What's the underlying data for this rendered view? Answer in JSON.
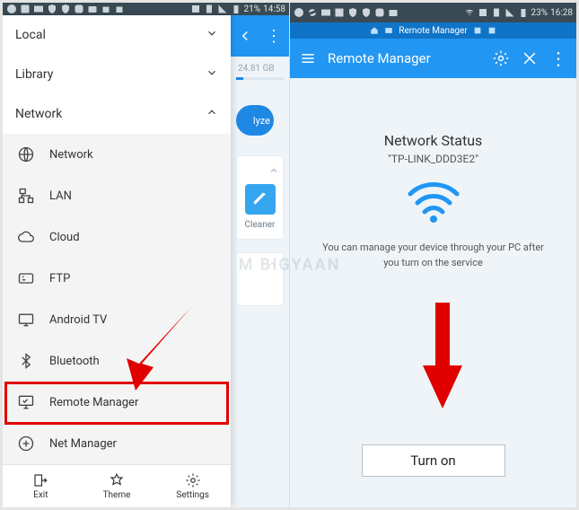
{
  "watermark": "M   BIGYAAN",
  "left": {
    "statusbar": {
      "battery": "21%",
      "time": "14:58"
    },
    "categories": {
      "local": "Local",
      "library": "Library",
      "network": "Network"
    },
    "network_items": [
      {
        "key": "network",
        "label": "Network"
      },
      {
        "key": "lan",
        "label": "LAN"
      },
      {
        "key": "cloud",
        "label": "Cloud"
      },
      {
        "key": "ftp",
        "label": "FTP"
      },
      {
        "key": "androidtv",
        "label": "Android TV"
      },
      {
        "key": "bluetooth",
        "label": "Bluetooth"
      },
      {
        "key": "remotemanager",
        "label": "Remote Manager"
      },
      {
        "key": "netmanager",
        "label": "Net Manager"
      }
    ],
    "bottom": {
      "exit": "Exit",
      "theme": "Theme",
      "settings": "Settings"
    },
    "peek": {
      "storage": "24.81 GB",
      "analyze": "lyze",
      "cleaner": "Cleaner"
    }
  },
  "right": {
    "statusbar": {
      "battery": "23%",
      "time": "16:28"
    },
    "window_title": "Remote Manager",
    "appbar_title": "Remote Manager",
    "net_title": "Network Status",
    "net_ssid": "\"TP-LINK_DDD3E2\"",
    "net_desc": "You can manage your device through your PC after you turn on the service",
    "turn_on": "Turn on"
  }
}
